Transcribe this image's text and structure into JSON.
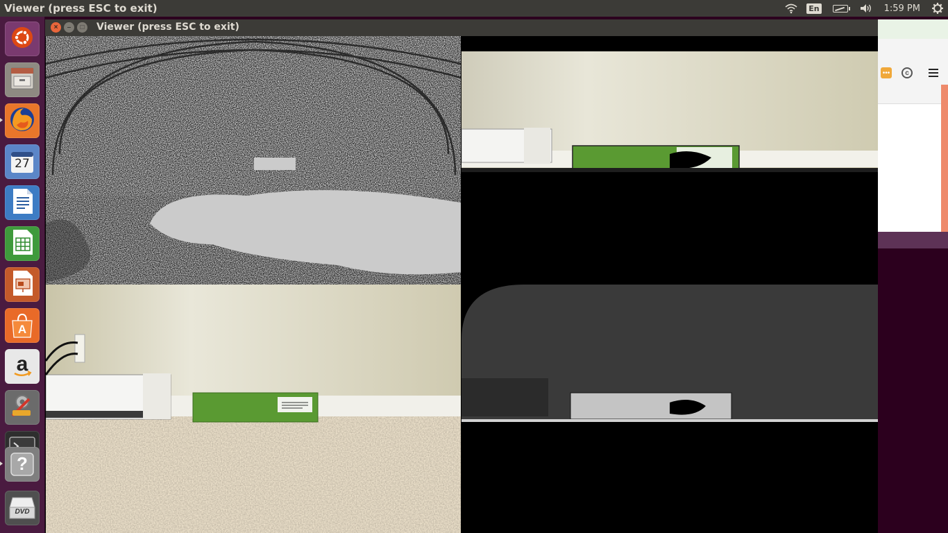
{
  "top_panel": {
    "title": "Viewer (press ESC to exit)",
    "language": "En",
    "clock": "1:59 PM",
    "icons": [
      "wifi-icon",
      "keyboard-language-icon",
      "battery-icon",
      "volume-icon",
      "system-gear-icon"
    ]
  },
  "launcher": {
    "items": [
      {
        "name": "ubuntu-dash",
        "icon": "ubuntu-logo-icon"
      },
      {
        "name": "files",
        "icon": "file-cabinet-icon"
      },
      {
        "name": "firefox",
        "icon": "firefox-icon"
      },
      {
        "name": "calendar",
        "icon": "calendar-icon",
        "label": "27"
      },
      {
        "name": "writer",
        "icon": "document-icon"
      },
      {
        "name": "calc",
        "icon": "spreadsheet-icon"
      },
      {
        "name": "impress",
        "icon": "presentation-icon"
      },
      {
        "name": "software-center",
        "icon": "shopping-bag-icon",
        "label": "A"
      },
      {
        "name": "amazon",
        "icon": "amazon-icon",
        "label": "a"
      },
      {
        "name": "system-settings",
        "icon": "settings-tools-icon"
      },
      {
        "name": "terminal",
        "icon": "terminal-icon"
      },
      {
        "name": "help",
        "icon": "help-icon",
        "label": "?"
      },
      {
        "name": "dvd",
        "icon": "dvd-drive-icon",
        "label": "DVD"
      }
    ]
  },
  "viewer": {
    "title": "Viewer (press ESC to exit)",
    "panes": [
      {
        "name": "registered-depth-noise-view"
      },
      {
        "name": "masked-color-view"
      },
      {
        "name": "rgb-camera-view"
      },
      {
        "name": "depth-grayscale-view"
      }
    ]
  },
  "colors": {
    "panel_bg": "#3c3b37",
    "launcher_bg": "#4a1b40",
    "desktop_bg": "#2c001e",
    "close_button": "#e9663b",
    "box_green": "#5a9a32",
    "wall": "#dedbc9"
  }
}
